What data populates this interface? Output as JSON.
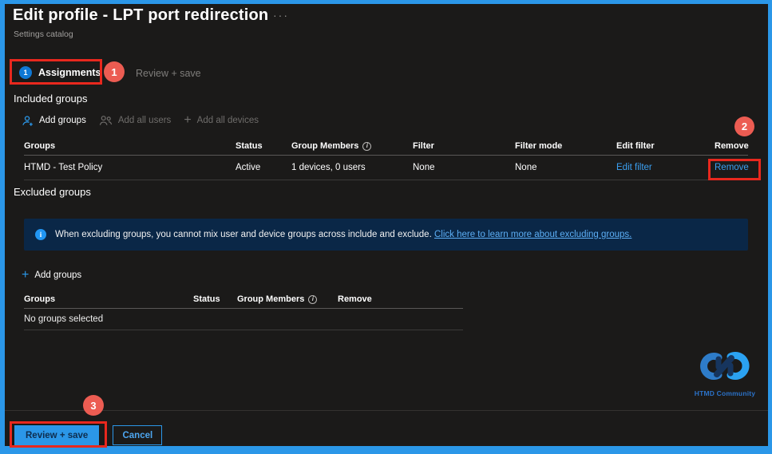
{
  "colors": {
    "accent": "#2b97e8",
    "annotation-red": "#e8281e",
    "badge-red": "#ec5c52",
    "step-blue": "#0f78d4",
    "link-blue": "#3ba0f2",
    "banner-bg": "#0a2747",
    "banner-link": "#5caef5",
    "logo-blue": "#2b72c8"
  },
  "header": {
    "title": "Edit profile - LPT port redirection",
    "more": "···",
    "subtitle": "Settings catalog"
  },
  "tabs": {
    "assignments": {
      "step": "1",
      "label": "Assignments"
    },
    "review_save": {
      "label": "Review + save"
    }
  },
  "annotations": {
    "badge1": "1",
    "badge2": "2",
    "badge3": "3"
  },
  "included": {
    "heading": "Included groups",
    "toolbar": {
      "add_groups": "Add groups",
      "add_all_users": "Add all users",
      "add_all_devices": "Add all devices"
    },
    "table": {
      "columns": [
        "Groups",
        "Status",
        "Group Members",
        "Filter",
        "Filter mode",
        "Edit filter",
        "Remove"
      ],
      "row": {
        "group": "HTMD - Test Policy",
        "status": "Active",
        "members": "1 devices, 0 users",
        "filter": "None",
        "filter_mode": "None",
        "edit_filter": "Edit filter",
        "remove": "Remove"
      }
    }
  },
  "excluded": {
    "heading": "Excluded groups",
    "banner": {
      "text": "When excluding groups, you cannot mix user and device groups across include and exclude.",
      "link": "Click here to learn more about excluding groups."
    },
    "toolbar": {
      "add_groups": "Add groups"
    },
    "table": {
      "columns": [
        "Groups",
        "Status",
        "Group Members",
        "Remove"
      ],
      "empty": "No groups selected"
    }
  },
  "footer": {
    "review_save": "Review + save",
    "cancel": "Cancel"
  },
  "logo": {
    "label": "HTMD Community"
  }
}
